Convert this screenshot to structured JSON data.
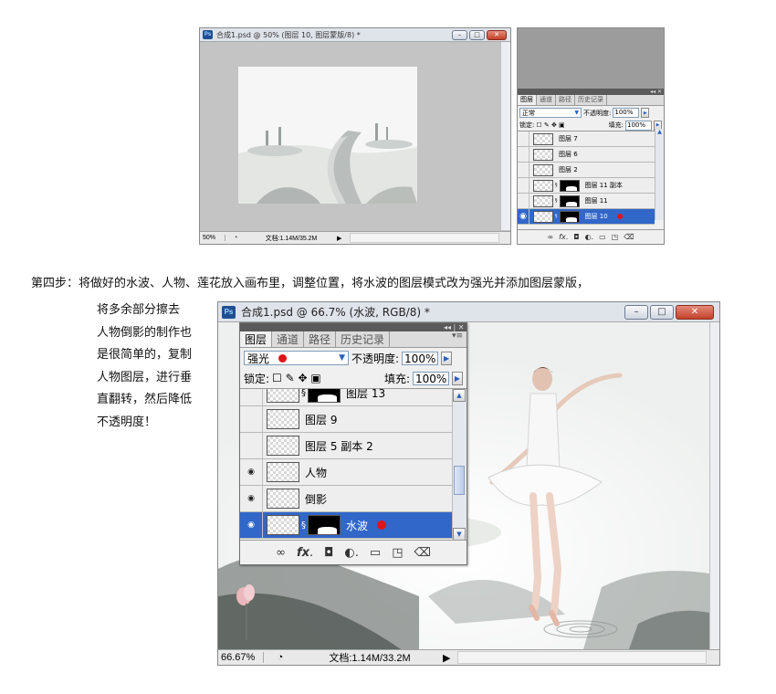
{
  "top_window": {
    "ps_badge": "Ps",
    "title": "合成1.psd @ 50% (图层 10, 图层蒙版/8) *",
    "zoom": "50%",
    "doc_info": "文档:1.14M/35.2M"
  },
  "top_panel": {
    "tabs": [
      "图层",
      "通道",
      "路径",
      "历史记录"
    ],
    "blend_mode": "正常",
    "opacity_label": "不透明度:",
    "opacity_value": "100%",
    "lock_label": "锁定:",
    "fill_label": "填充:",
    "fill_value": "100%",
    "layers": [
      {
        "name": "图层 7",
        "visible": false,
        "mask": false,
        "selected": false
      },
      {
        "name": "图层 6",
        "visible": false,
        "mask": false,
        "selected": false
      },
      {
        "name": "图层 2",
        "visible": false,
        "mask": false,
        "selected": false
      },
      {
        "name": "图层 11 副本",
        "visible": false,
        "mask": true,
        "selected": false
      },
      {
        "name": "图层 11",
        "visible": false,
        "mask": true,
        "selected": false
      },
      {
        "name": "图层 10",
        "visible": true,
        "mask": true,
        "selected": true
      }
    ]
  },
  "paragraph": {
    "line1": "第四步：将做好的水波、人物、莲花放入画布里，调整位置，将水波的图层模式改为强光并添加图层蒙版，",
    "line2": "将多余部分擦去",
    "line3": "人物倒影的制作也",
    "line4": "是很简单的，复制",
    "line5": "人物图层，进行垂",
    "line6": "直翻转，然后降低",
    "line7": "不透明度！"
  },
  "bottom_window": {
    "ps_badge": "Ps",
    "title": "合成1.psd @ 66.7% (水波, RGB/8) *",
    "zoom": "66.67%",
    "doc_info": "文档:1.14M/33.2M"
  },
  "bottom_panel": {
    "tabs": [
      "图层",
      "通道",
      "路径",
      "历史记录"
    ],
    "blend_mode": "强光",
    "opacity_label": "不透明度:",
    "opacity_value": "100%",
    "lock_label": "锁定:",
    "fill_label": "填充:",
    "fill_value": "100%",
    "layers": [
      {
        "name": "图层 13",
        "visible": false,
        "mask": true,
        "selected": false
      },
      {
        "name": "图层 9",
        "visible": false,
        "mask": false,
        "selected": false
      },
      {
        "name": "图层 5 副本 2",
        "visible": false,
        "mask": false,
        "selected": false
      },
      {
        "name": "人物",
        "visible": true,
        "mask": false,
        "selected": false
      },
      {
        "name": "倒影",
        "visible": true,
        "mask": false,
        "selected": false
      },
      {
        "name": "水波",
        "visible": true,
        "mask": true,
        "selected": true
      }
    ]
  },
  "colors": {
    "selection_blue": "#3167c9",
    "marker_red": "#e0141b",
    "ps_blue": "#1f4f93"
  }
}
